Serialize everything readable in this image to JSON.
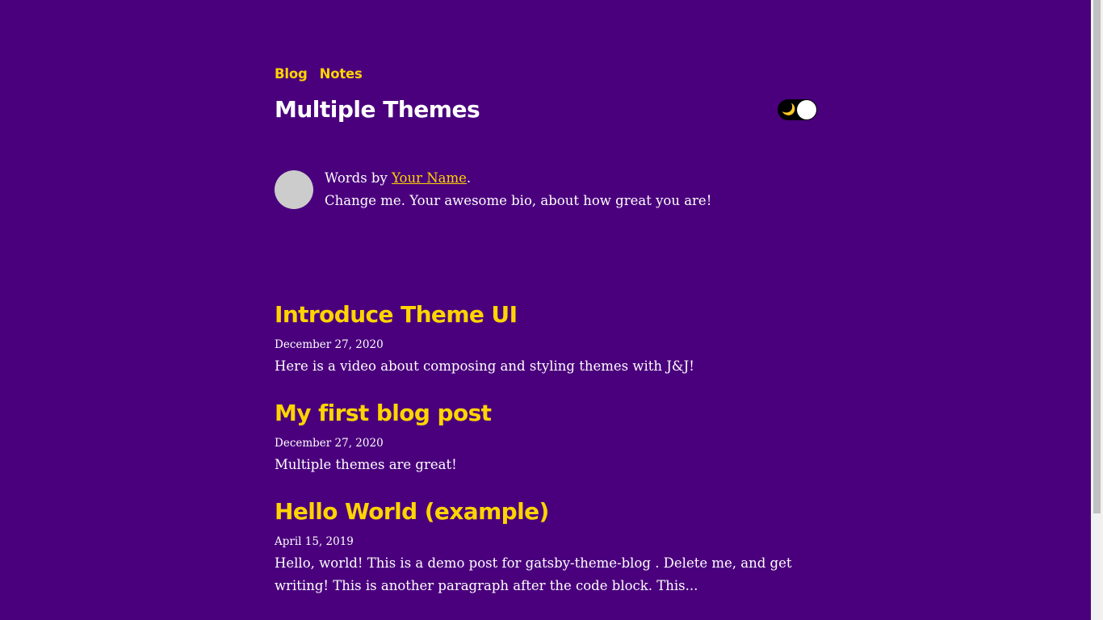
{
  "nav": {
    "items": [
      {
        "label": "Blog"
      },
      {
        "label": "Notes"
      }
    ]
  },
  "site": {
    "title": "Multiple Themes"
  },
  "theme_toggle": {
    "icon": "moon-icon",
    "glyph": "🌙",
    "state": "dark"
  },
  "bio": {
    "prefix": "Words by ",
    "author_link": "Your Name",
    "suffix": ".",
    "text": "Change me. Your awesome bio, about how great you are!"
  },
  "posts": [
    {
      "title": "Introduce Theme UI",
      "date": "December 27, 2020",
      "excerpt": "Here is a video about composing and styling themes with J&J!"
    },
    {
      "title": "My first blog post",
      "date": "December 27, 2020",
      "excerpt": "Multiple themes are great!"
    },
    {
      "title": "Hello World (example)",
      "date": "April 15, 2019",
      "excerpt": "Hello, world! This is a demo post for gatsby-theme-blog . Delete me, and get writing! This is another paragraph after the code block. This..."
    }
  ],
  "colors": {
    "background": "#4a007d",
    "accent": "#ffd400",
    "text": "#ffffff",
    "avatar": "#cccccc"
  }
}
